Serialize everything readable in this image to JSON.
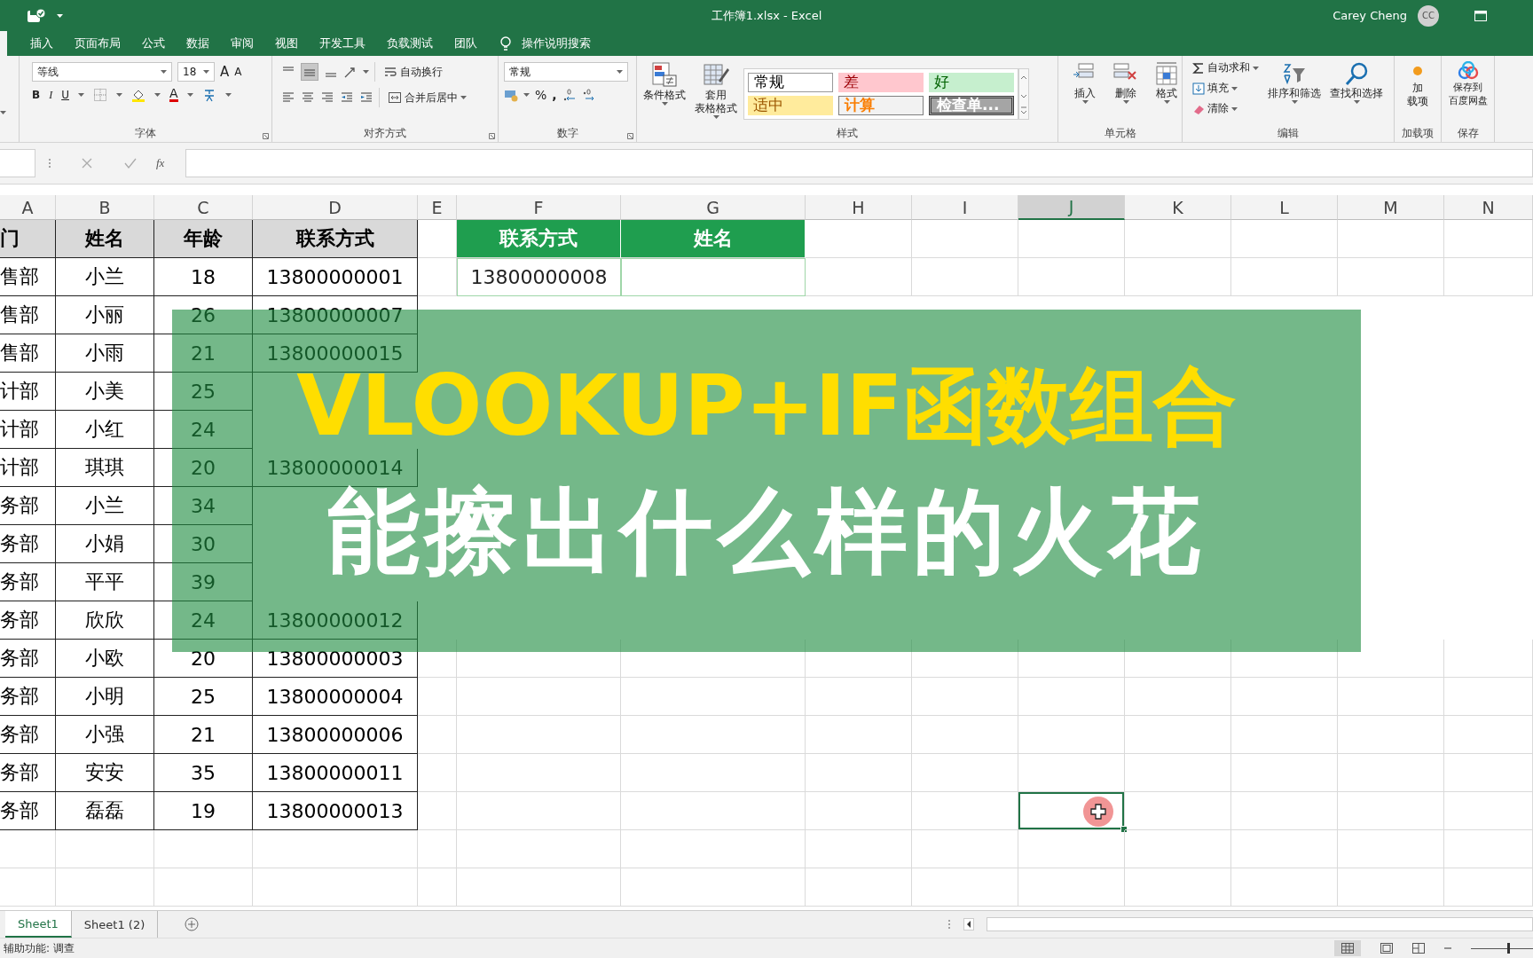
{
  "title_bar": {
    "title": "工作簿1.xlsx  -  Excel",
    "user": "Carey Cheng",
    "avatar": "CC"
  },
  "ribbon_tabs": [
    {
      "label": "插入",
      "selected": false
    },
    {
      "label": "页面布局",
      "selected": false
    },
    {
      "label": "公式",
      "selected": false
    },
    {
      "label": "数据",
      "selected": false
    },
    {
      "label": "审阅",
      "selected": false
    },
    {
      "label": "视图",
      "selected": false
    },
    {
      "label": "开发工具",
      "selected": false
    },
    {
      "label": "负载测试",
      "selected": false
    },
    {
      "label": "团队",
      "selected": false
    }
  ],
  "tell_me": "操作说明搜索",
  "ribbon": {
    "font": {
      "label": "字体",
      "font_name": "等线",
      "font_size": "18",
      "grow": "A",
      "shrink": "A",
      "bold": "B",
      "italic": "I",
      "underline": "U",
      "font_color": "A"
    },
    "alignment": {
      "label": "对齐方式",
      "wrap": "自动换行",
      "merge": "合并后居中"
    },
    "number": {
      "label": "数字",
      "format": "常规",
      "percent": "%",
      "comma": ","
    },
    "styles": {
      "label": "样式",
      "conditional": "条件格式",
      "table": [
        "套用",
        "表格格式"
      ],
      "gallery": [
        {
          "label": "常规",
          "kind": "normal"
        },
        {
          "label": "差",
          "kind": "bad"
        },
        {
          "label": "好",
          "kind": "good"
        },
        {
          "label": "适中",
          "kind": "neutral"
        },
        {
          "label": "计算",
          "kind": "calculation"
        },
        {
          "label": "检查单...",
          "kind": "check"
        }
      ]
    },
    "cells": {
      "label": "单元格",
      "buttons": [
        "插入",
        "删除",
        "格式"
      ]
    },
    "editing": {
      "label": "编辑",
      "autosum": "自动求和",
      "fill": "填充",
      "clear": "清除",
      "sort": "排序和筛选",
      "find": "查找和选择"
    },
    "addins": {
      "label": "加载项",
      "button": [
        "加",
        "载项"
      ]
    },
    "save": {
      "label": "保存",
      "button": [
        "保存到",
        "百度网盘"
      ]
    }
  },
  "formula_bar": {
    "fx": "fx"
  },
  "columns": [
    {
      "label": "A",
      "selected": false
    },
    {
      "label": "B",
      "selected": false
    },
    {
      "label": "C",
      "selected": false
    },
    {
      "label": "D",
      "selected": false
    },
    {
      "label": "E",
      "selected": false
    },
    {
      "label": "F",
      "selected": false
    },
    {
      "label": "G",
      "selected": false
    },
    {
      "label": "H",
      "selected": false
    },
    {
      "label": "I",
      "selected": false
    },
    {
      "label": "J",
      "selected": true
    },
    {
      "label": "K",
      "selected": false
    },
    {
      "label": "L",
      "selected": false
    },
    {
      "label": "M",
      "selected": false
    },
    {
      "label": "N",
      "selected": false
    }
  ],
  "table": {
    "headers": [
      "门",
      "姓名",
      "年龄",
      "联系方式"
    ],
    "rows": [
      [
        "售部",
        "小兰",
        "18",
        "13800000001"
      ],
      [
        "售部",
        "小丽",
        "26",
        "13800000007"
      ],
      [
        "售部",
        "小雨",
        "21",
        "13800000015"
      ],
      [
        "计部",
        "小美",
        "25",
        null
      ],
      [
        "计部",
        "小红",
        "24",
        null
      ],
      [
        "计部",
        "琪琪",
        "20",
        "13800000014"
      ],
      [
        "务部",
        "小兰",
        "34",
        null
      ],
      [
        "务部",
        "小娟",
        "30",
        null
      ],
      [
        "务部",
        "平平",
        "39",
        null
      ],
      [
        "务部",
        "欣欣",
        "24",
        "13800000012"
      ],
      [
        "务部",
        "小欧",
        "20",
        "13800000003"
      ],
      [
        "务部",
        "小明",
        "25",
        "13800000004"
      ],
      [
        "务部",
        "小强",
        "21",
        "13800000006"
      ],
      [
        "务部",
        "安安",
        "35",
        "13800000011"
      ],
      [
        "务部",
        "磊磊",
        "19",
        "13800000013"
      ]
    ]
  },
  "lookup": {
    "headers": [
      "联系方式",
      "姓名"
    ],
    "value": "13800000008"
  },
  "banner": {
    "title": "VLOOKUP+IF函数组合",
    "subtitle": "能擦出什么样的火花"
  },
  "sheet_tabs": [
    {
      "label": "Sheet1",
      "selected": true
    },
    {
      "label": "Sheet1 (2)",
      "selected": false
    }
  ],
  "status_bar": {
    "text": "辅助功能: 调查",
    "zoom": {
      "level": 0.6
    }
  }
}
